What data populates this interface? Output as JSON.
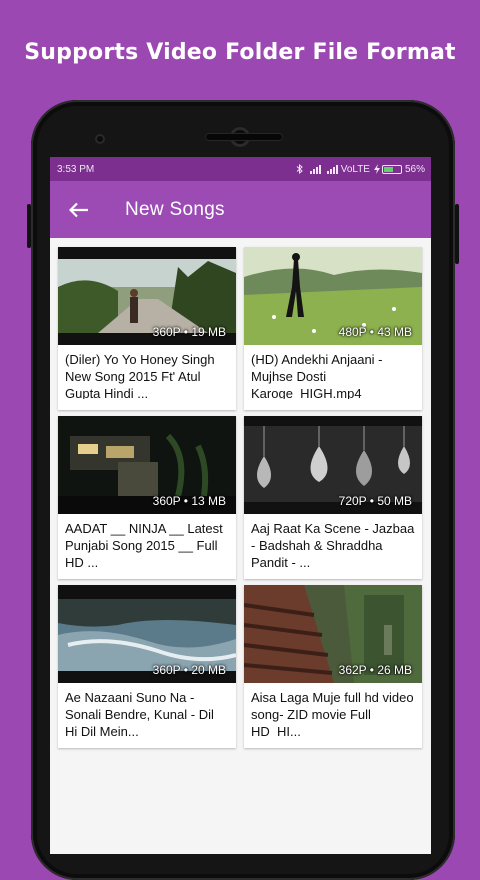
{
  "promo": {
    "headline": "Supports Video Folder File Format"
  },
  "status_bar": {
    "time": "3:53 PM",
    "network": "VoLTE",
    "battery": "56%",
    "battery_level": 0.56,
    "icons": [
      "bluetooth-icon",
      "signal-icon",
      "signal-icon",
      "charging-icon",
      "battery-icon"
    ]
  },
  "toolbar": {
    "title": "New Songs",
    "back_icon": "arrow-left-icon"
  },
  "videos": [
    {
      "title": "(Diler)  Yo Yo Honey Singh New Song 2015 Ft' Atul Gupta   Hindi ...",
      "meta": "360P • 19 MB"
    },
    {
      "title": "(HD) Andekhi Anjaani - Mujhse Dosti Karoge_HIGH.mp4",
      "meta": "480P • 43 MB"
    },
    {
      "title": "AADAT  __ NINJA __ Latest Punjabi Song 2015 __ Full HD ...",
      "meta": "360P • 13 MB"
    },
    {
      "title": "Aaj Raat Ka Scene - Jazbaa - Badshah & Shraddha Pandit - ...",
      "meta": "720P • 50 MB"
    },
    {
      "title": "Ae Nazaani Suno Na - Sonali Bendre, Kunal - Dil Hi Dil Mein...",
      "meta": "360P • 20 MB"
    },
    {
      "title": "Aisa Laga Muje full hd video song- ZID movie Full HD_HI...",
      "meta": "362P • 26 MB"
    }
  ],
  "colors": {
    "accent": "#9c4bb5",
    "status_bar": "#7c2f8f",
    "background": "#9b48b3"
  }
}
